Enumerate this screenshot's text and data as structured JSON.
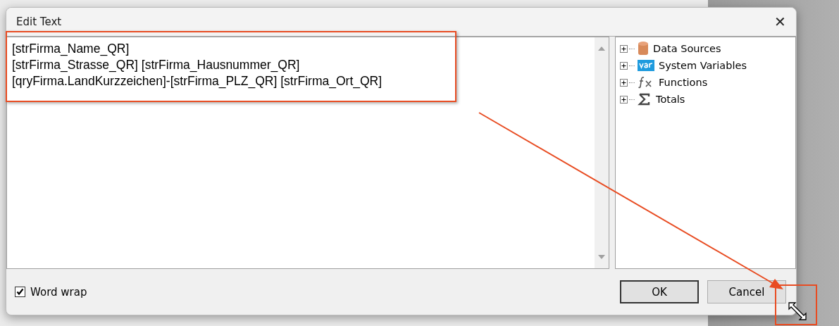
{
  "dialog": {
    "title": "Edit Text",
    "close": "✕"
  },
  "editor": {
    "lines": [
      "[strFirma_Name_QR]",
      "[strFirma_Strasse_QR] [strFirma_Hausnummer_QR]",
      "[qryFirma.LandKurzzeichen]-[strFirma_PLZ_QR] [strFirma_Ort_QR]"
    ]
  },
  "tree": {
    "items": [
      {
        "label": "Data Sources",
        "kind": "database",
        "expanded": false
      },
      {
        "label": "System Variables",
        "kind": "variable",
        "expanded": false
      },
      {
        "label": "Functions",
        "kind": "function",
        "expanded": false
      },
      {
        "label": "Totals",
        "kind": "sum",
        "expanded": false
      }
    ]
  },
  "word_wrap": {
    "label": "Word wrap",
    "checked": true
  },
  "buttons": [
    "OK",
    "Cancel"
  ]
}
